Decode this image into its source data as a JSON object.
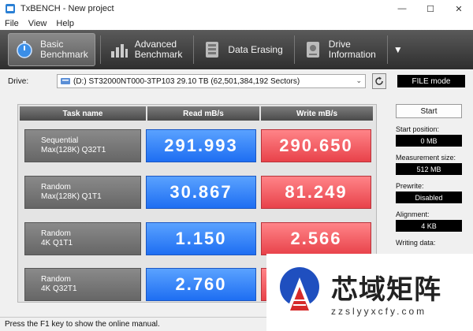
{
  "window": {
    "title": "TxBENCH - New project"
  },
  "menu": [
    "File",
    "View",
    "Help"
  ],
  "toolbar": {
    "basic": {
      "line1": "Basic",
      "line2": "Benchmark"
    },
    "advanced": {
      "line1": "Advanced",
      "line2": "Benchmark"
    },
    "erasing": {
      "line1": "Data Erasing"
    },
    "driveinfo": {
      "line1": "Drive",
      "line2": "Information"
    },
    "more": "▼"
  },
  "drive": {
    "label": "Drive:",
    "selected": "(D:) ST32000NT000-3TP103  29.10 TB (62,501,384,192 Sectors)",
    "mode": "FILE mode"
  },
  "table": {
    "headers": {
      "task": "Task name",
      "read": "Read mB/s",
      "write": "Write mB/s"
    },
    "rows": [
      {
        "name1": "Sequential",
        "name2": "Max(128K) Q32T1",
        "read": "291.993",
        "write": "290.650"
      },
      {
        "name1": "Random",
        "name2": "Max(128K) Q1T1",
        "read": "30.867",
        "write": "81.249"
      },
      {
        "name1": "Random",
        "name2": "4K Q1T1",
        "read": "1.150",
        "write": "2.566"
      },
      {
        "name1": "Random",
        "name2": "4K Q32T1",
        "read": "2.760",
        "write": ""
      }
    ]
  },
  "side": {
    "start": "Start",
    "start_position": {
      "label": "Start position:",
      "value": "0 MB"
    },
    "measurement_size": {
      "label": "Measurement size:",
      "value": "512 MB"
    },
    "prewrite": {
      "label": "Prewrite:",
      "value": "Disabled"
    },
    "alignment": {
      "label": "Alignment:",
      "value": "4 KB"
    },
    "writing_data": {
      "label": "Writing data:"
    }
  },
  "status": "Press the F1 key to show the online manual.",
  "watermark": {
    "text": "芯域矩阵",
    "url": "zzslyyxcfy.com"
  },
  "colors": {
    "read_blue": "#1e6ef2",
    "write_red": "#e8424a",
    "toolbar_dark": "#2e2e2e"
  }
}
